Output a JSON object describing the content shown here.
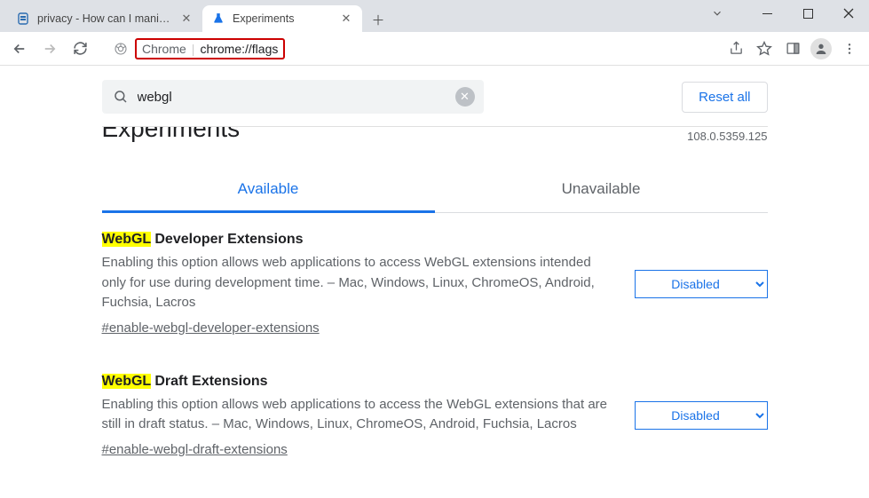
{
  "tabs": [
    {
      "title": "privacy - How can I manipulate th",
      "active": false,
      "icon": "stackexchange"
    },
    {
      "title": "Experiments",
      "active": true,
      "icon": "flask"
    }
  ],
  "omnibox": {
    "label": "Chrome",
    "url": "chrome://flags"
  },
  "search": {
    "value": "webgl"
  },
  "reset_label": "Reset all",
  "page_title": "Experiments",
  "version": "108.0.5359.125",
  "page_tabs": {
    "available": "Available",
    "unavailable": "Unavailable"
  },
  "flags": [
    {
      "highlight": "WebGL",
      "title_rest": " Developer Extensions",
      "desc": "Enabling this option allows web applications to access WebGL extensions intended only for use during development time. – Mac, Windows, Linux, ChromeOS, Android, Fuchsia, Lacros",
      "link": "#enable-webgl-developer-extensions",
      "state": "Disabled"
    },
    {
      "highlight": "WebGL",
      "title_rest": " Draft Extensions",
      "desc": "Enabling this option allows web applications to access the WebGL extensions that are still in draft status. – Mac, Windows, Linux, ChromeOS, Android, Fuchsia, Lacros",
      "link": "#enable-webgl-draft-extensions",
      "state": "Disabled"
    }
  ]
}
